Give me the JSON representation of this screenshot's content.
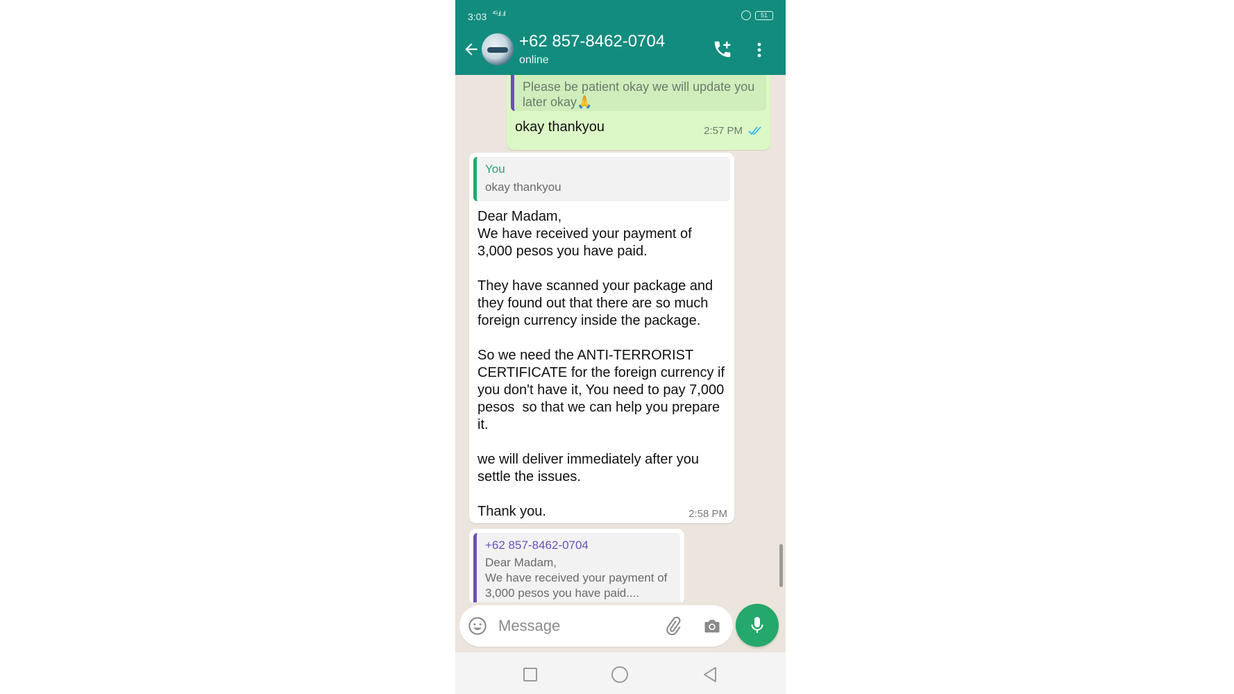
{
  "status_bar": {
    "time": "3:03",
    "signal": "⁴ᴳ.ıl .ıl",
    "battery": "51"
  },
  "header": {
    "contact_name": "+62 857-8462-0704",
    "contact_status": "online"
  },
  "messages": {
    "outgoing": {
      "quoted_text": "Please be patient okay we will update you later okay🙏",
      "text": "okay thankyou",
      "time": "2:57 PM"
    },
    "incoming": {
      "quote_author": "You",
      "quote_text": "okay thankyou",
      "body": "Dear Madam,\nWe have received your payment of 3,000 pesos you have paid.\n\nThey have scanned your package and they found out that there are so much foreign currency inside the package.\n\nSo we need the ANTI-TERRORIST CERTIFICATE for the foreign currency if you don't have it, You need to pay 7,000 pesos  so that we can help you prepare it.\n\nwe will deliver immediately after you settle the issues.\n\nThank you.",
      "time": "2:58 PM"
    },
    "forwarded_quote": {
      "author": "+62 857-8462-0704",
      "text": "Dear Madam,\nWe have received your payment of 3,000 pesos you have paid...."
    }
  },
  "composer": {
    "placeholder": "Message"
  },
  "colors": {
    "header": "#128c7e",
    "accent": "#25a86b",
    "outgoing_bubble": "#dcf8c6",
    "chat_bg": "#ece5dd"
  }
}
